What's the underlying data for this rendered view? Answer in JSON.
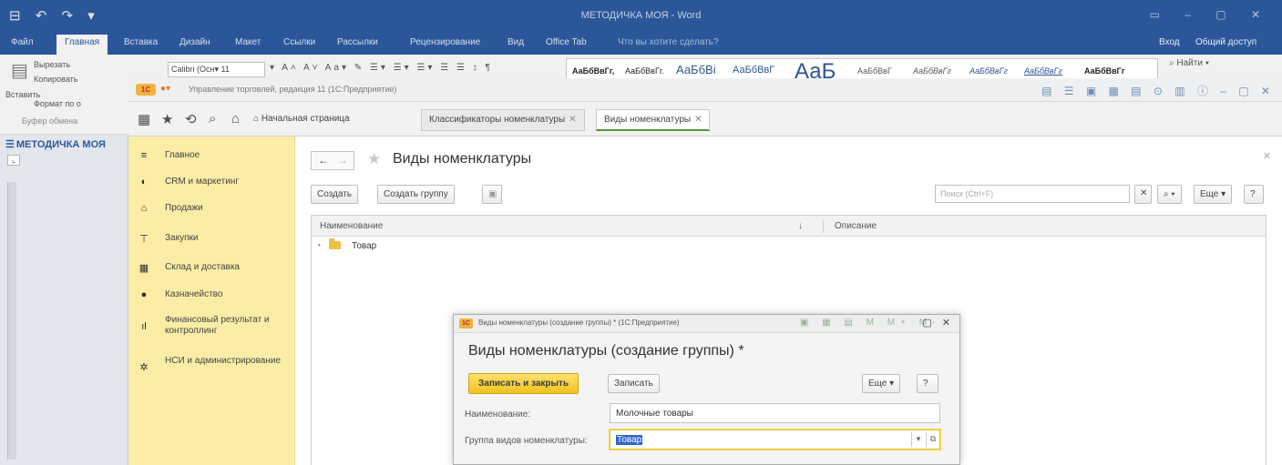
{
  "word": {
    "title": "МЕТОДИЧКА МОЯ - Word",
    "quick_access": "⊟ ↶ ↷ ▾",
    "window_controls": "▭ – ▢ ✕",
    "tabs": [
      "Файл",
      "Главная",
      "Вставка",
      "Дизайн",
      "Макет",
      "Ссылки",
      "Рассылки",
      "Рецензирование",
      "Вид",
      "Office Tab",
      "Что вы хотите сделать?"
    ],
    "right_tabs": [
      "Вход",
      "Общий доступ"
    ],
    "clipboard": {
      "paste": "Вставить",
      "cut": "Вырезать",
      "copy": "Копировать",
      "format": "Формат по о",
      "group": "Буфер обмена"
    },
    "font_name": "Calibri (Осн▾ 11",
    "styles": [
      "АаБбВвГг,",
      "АаБбВвГг.",
      "АаБбВі",
      "АаБбВвГ",
      "АаБ",
      "АаБбВвГ",
      "АаБбВвГг",
      "АаБбВвГг",
      "АаБбВвГг",
      "АаБбВвГг"
    ],
    "find": "Найти",
    "nav_title": "МЕТОДИЧКА МОЯ"
  },
  "app": {
    "title": "Управление торговлей, редакция 11  (1С:Предприятие)",
    "tabs": [
      {
        "label": "Начальная страница"
      },
      {
        "label": "Классификаторы номенклатуры"
      },
      {
        "label": "Виды номенклатуры"
      }
    ],
    "sidebar": [
      {
        "icon": "≡",
        "label": "Главное"
      },
      {
        "icon": "◐",
        "label": "CRM и маркетинг"
      },
      {
        "icon": "⌂",
        "label": "Продажи"
      },
      {
        "icon": "⊤",
        "label": "Закупки"
      },
      {
        "icon": "▦",
        "label": "Склад и доставка"
      },
      {
        "icon": "●",
        "label": "Казначейство"
      },
      {
        "icon": "ıl",
        "label": "Финансовый результат и контроллинг"
      },
      {
        "icon": "✲",
        "label": "НСИ и администрирование"
      }
    ],
    "form": {
      "title": "Виды номенклатуры",
      "create": "Создать",
      "create_group": "Создать группу",
      "search_placeholder": "Поиск (Ctrl+F)",
      "more": "Еще",
      "help": "?",
      "col_name": "Наименование",
      "col_desc": "Описание",
      "row": "Товар"
    }
  },
  "dialog": {
    "caption": "Виды номенклатуры (создание группы) * (1С:Предприятие)",
    "tools": "▣ ▦ ▤ M M+ M-",
    "header": "Виды номенклатуры (создание группы) *",
    "save_close": "Записать и закрыть",
    "save": "Записать",
    "more": "Еще",
    "help": "?",
    "name_label": "Наименование:",
    "name_value": "Молочные товары",
    "group_label": "Группа видов номенклатуры:",
    "group_value": "Товар"
  }
}
